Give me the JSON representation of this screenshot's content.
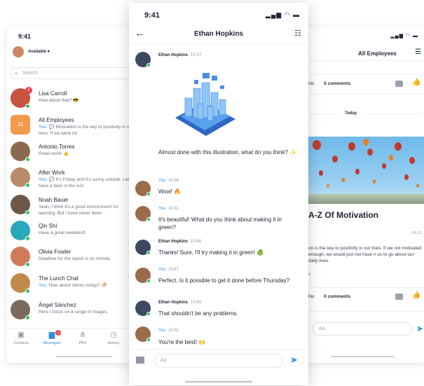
{
  "left": {
    "time": "9:41",
    "status_label": "Available ▾",
    "search_placeholder": "Search",
    "conversations": [
      {
        "name": "Lisa Carroll",
        "preview": "How about that? 😎",
        "color": "#c8553d",
        "badge": "1"
      },
      {
        "name": "All Employees",
        "initial": "11",
        "you": "You: ",
        "preview": "💬 Motivation is the key to positivity in our lives. If we were no",
        "color": "#f2994a"
      },
      {
        "name": "Antonio Torres",
        "preview": "Great work! 👍",
        "color": "#8a6a4f"
      },
      {
        "name": "After Work",
        "you": "You: ",
        "preview": "💬 It's Friday and it's sunny outside. Let's have a beer in the sun",
        "color": "#b98b6a"
      },
      {
        "name": "Noah Bauer",
        "preview": "Yeah, I think it's a good environment for learning. But I have never been",
        "color": "#6d5847"
      },
      {
        "name": "Qin Shi",
        "preview": "Have a great weekend!",
        "color": "#2aa7b8"
      },
      {
        "name": "Olivia Fowler",
        "preview": "Deadline for the report is on monda",
        "color": "#d07a5a"
      },
      {
        "name": "The Lunch Chat",
        "you": "You: ",
        "preview": "How about ramen today? 🍜",
        "color": "#c18a4a"
      },
      {
        "name": "Ángel Sánchez",
        "preview": "Here I focus on a range of images.",
        "color": "#7b6a5d"
      }
    ],
    "nav": [
      {
        "label": "Contacts",
        "glyph": "▣"
      },
      {
        "label": "Messages",
        "glyph": "▆",
        "badge": "1"
      },
      {
        "label": "PBX",
        "glyph": "⋔"
      },
      {
        "label": "History",
        "glyph": "◷"
      }
    ]
  },
  "center": {
    "time": "9:41",
    "status_icons": "▂▄▆ ◠ ▬",
    "title": "Ethan Hopkins",
    "messages": [
      {
        "sender": "Ethan Hopkins",
        "time": "10:27",
        "text": "Almost done with this illustration, what do you think? ✨",
        "mine": false
      },
      {
        "sender": "You",
        "time": "10:34",
        "text": "Wow! 🔥",
        "mine": true
      },
      {
        "sender": "You",
        "time": "10:41",
        "text": "It's beautiful! What do you think about making it in green?",
        "mine": true
      },
      {
        "sender": "Ethan Hopkins",
        "time": "10:45",
        "text": "Thanks! Sure, I'll try making it in green! 🍏",
        "mine": false
      },
      {
        "sender": "You",
        "time": "10:47",
        "text": "Perfect. Is it possible to get it done before Thursday?",
        "mine": true
      },
      {
        "sender": "Ethan Hopkins",
        "time": "10:49",
        "text": "That shouldn't be any problems.",
        "mine": false
      },
      {
        "sender": "You",
        "time": "10:51",
        "text": "You're the best! 🙌",
        "mine": true
      }
    ],
    "input_placeholder": "Aa"
  },
  "right": {
    "status_icons": "▂▄▆ ◠ ▬",
    "title": "All Employees",
    "comment_label_1": "his",
    "comments_1": "5 comments",
    "divider_label": "Today",
    "post_title": "A-Z Of Motivation",
    "post_time": "14:12",
    "post_body": "on is the key to positivity in our lives. If we not motivated enough, we would just not have n us to go about our daily lives.",
    "more": "e",
    "comment_label_2": "his",
    "comments_2": "0 comments",
    "input_placeholder": "Aa"
  }
}
